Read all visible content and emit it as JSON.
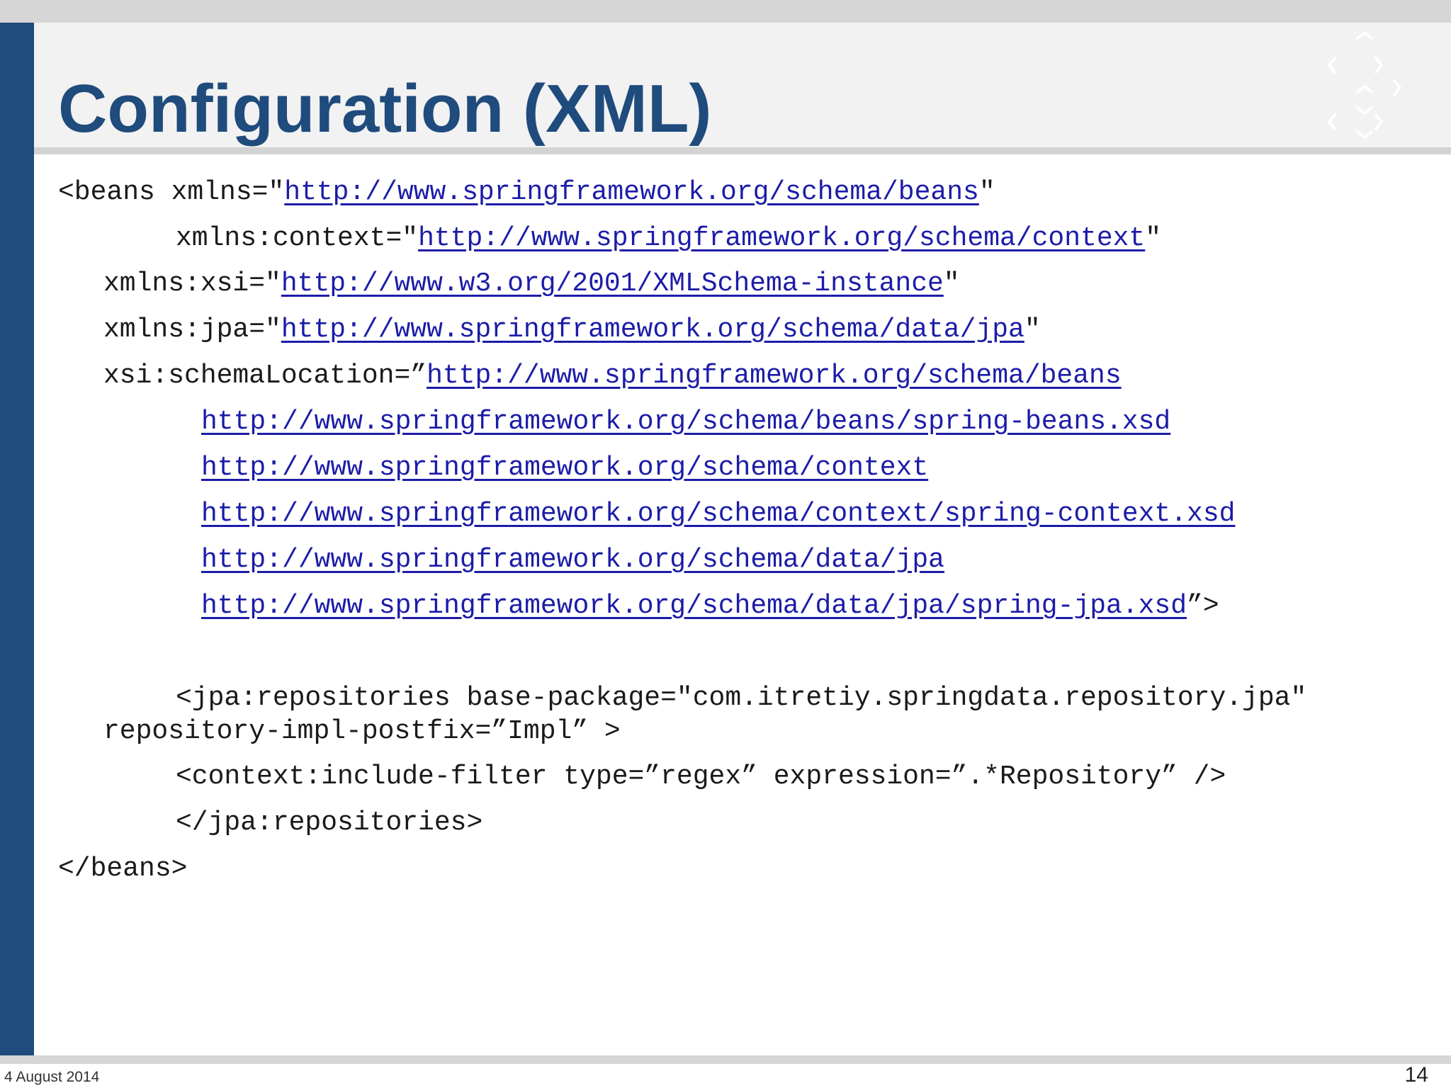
{
  "slide": {
    "title": "Configuration (XML)",
    "date": "4 August 2014",
    "page_number": "14"
  },
  "colors": {
    "accent": "#1f4b7d",
    "link": "#1c1ca8"
  },
  "code_lines": [
    {
      "prefix": "<beans xmlns=\"",
      "link": "http://www.springframework.org/schema/beans",
      "suffix": "\""
    },
    {
      "prefix": "xmlns:context=\"",
      "link": "http://www.springframework.org/schema/context",
      "suffix": "\""
    },
    {
      "prefix": "xmlns:xsi=\"",
      "link": "http://www.w3.org/2001/XMLSchema-instance",
      "suffix": "\""
    },
    {
      "prefix": "xmlns:jpa=\"",
      "link": "http://www.springframework.org/schema/data/jpa",
      "suffix": "\""
    },
    {
      "prefix": "xsi:schemaLocation=”",
      "link": "http://www.springframework.org/schema/beans",
      "suffix": ""
    },
    {
      "prefix": "",
      "link": "http://www.springframework.org/schema/beans/spring-beans.xsd",
      "suffix": ""
    },
    {
      "prefix": "",
      "link": "http://www.springframework.org/schema/context",
      "suffix": ""
    },
    {
      "prefix": "",
      "link": "http://www.springframework.org/schema/context/spring-context.xsd",
      "suffix": ""
    },
    {
      "prefix": "",
      "link": "http://www.springframework.org/schema/data/jpa",
      "suffix": ""
    },
    {
      "prefix": "",
      "link": "http://www.springframework.org/schema/data/jpa/spring-jpa.xsd",
      "suffix": "”>"
    },
    {
      "prefix": "<jpa:repositories base-package=\"com.itretiy.springdata.repository.jpa\"",
      "link": "",
      "suffix": ""
    },
    {
      "prefix": "repository-impl-postfix=”Impl” >",
      "link": "",
      "suffix": ""
    },
    {
      "prefix": "<context:include-filter type=”regex” expression=”.*Repository” />",
      "link": "",
      "suffix": ""
    },
    {
      "prefix": "</jpa:repositories>",
      "link": "",
      "suffix": ""
    },
    {
      "prefix": "</beans>",
      "link": "",
      "suffix": ""
    }
  ]
}
